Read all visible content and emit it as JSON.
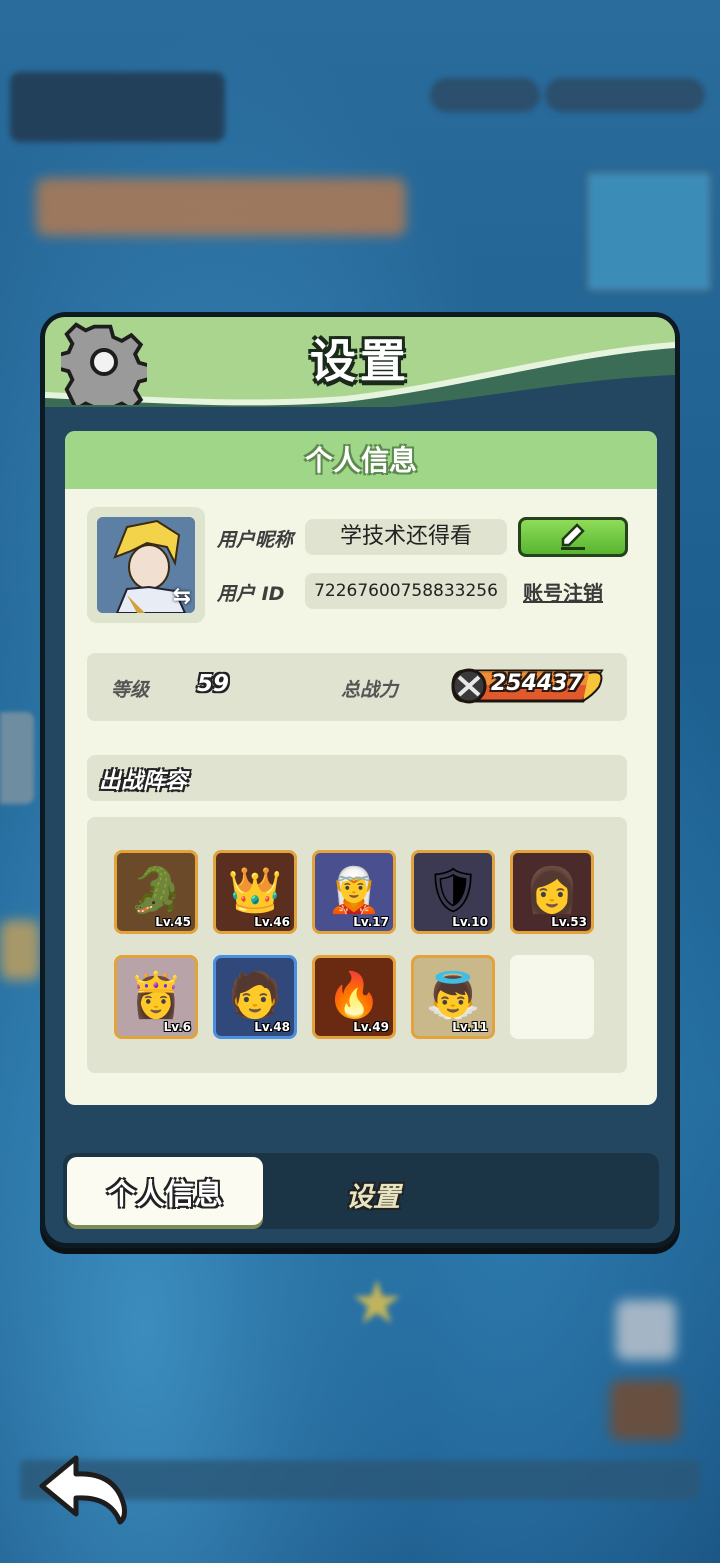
{
  "dialog": {
    "title": "设置"
  },
  "profile": {
    "section_title": "个人信息",
    "nickname_label": "用户昵称",
    "nickname": "学技术还得看",
    "id_label": "用户 ID",
    "user_id": "72267600758833256",
    "logout_label": "账号注销",
    "level_label": "等级",
    "level": "59",
    "power_label": "总战力",
    "power": "254437"
  },
  "lineup": {
    "title": "出战阵容",
    "heroes": [
      {
        "level": "Lv.45",
        "icon": "crocodile-hero-icon",
        "glyph": "🐊",
        "bg": "#6b4a2a"
      },
      {
        "level": "Lv.46",
        "icon": "king-hero-icon",
        "glyph": "👑",
        "bg": "#5a2f20"
      },
      {
        "level": "Lv.17",
        "icon": "blue-hair-hero-icon",
        "glyph": "🧝",
        "bg": "#4a4f8f"
      },
      {
        "level": "Lv.10",
        "icon": "armored-knight-hero-icon",
        "glyph": "🛡",
        "bg": "#3c3a52"
      },
      {
        "level": "Lv.53",
        "icon": "red-hair-hero-icon",
        "glyph": "👩",
        "bg": "#4a2a2a"
      },
      {
        "level": "Lv.6",
        "icon": "opera-hero-icon",
        "glyph": "👸",
        "bg": "#b8a4a8"
      },
      {
        "level": "Lv.48",
        "icon": "blonde-hero-icon",
        "glyph": "🧑",
        "bg": "#30487a"
      },
      {
        "level": "Lv.49",
        "icon": "fire-golem-hero-icon",
        "glyph": "🔥",
        "bg": "#6a2a12"
      },
      {
        "level": "Lv.11",
        "icon": "white-wing-hero-icon",
        "glyph": "👼",
        "bg": "#c9b88a"
      }
    ]
  },
  "tabs": {
    "active": "个人信息",
    "inactive": "设置"
  },
  "colors": {
    "header_green": "#9fd688",
    "panel_bg": "#f3f6e4",
    "frame": "#234761"
  }
}
